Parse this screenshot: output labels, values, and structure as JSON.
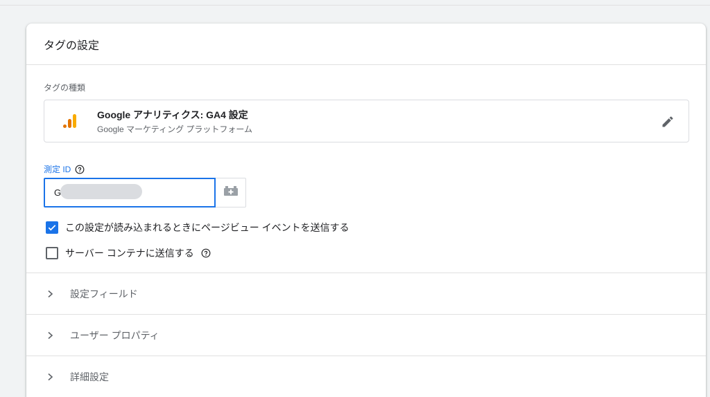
{
  "card": {
    "title": "タグの設定"
  },
  "tag_type": {
    "section_label": "タグの種類",
    "title": "Google アナリティクス: GA4 設定",
    "subtitle": "Google マーケティング プラットフォーム",
    "icon": "google-analytics-icon"
  },
  "measurement_id": {
    "label": "測定 ID",
    "value": "G"
  },
  "checkboxes": [
    {
      "label": "この設定が読み込まれるときにページビュー イベントを送信する",
      "checked": true
    },
    {
      "label": "サーバー コンテナに送信する",
      "checked": false
    }
  ],
  "sections": [
    {
      "label": "設定フィールド"
    },
    {
      "label": "ユーザー プロパティ"
    },
    {
      "label": "詳細設定"
    }
  ],
  "colors": {
    "accent": "#1a73e8",
    "analytics_orange": "#f9ab00",
    "analytics_dark_orange": "#e37400"
  }
}
